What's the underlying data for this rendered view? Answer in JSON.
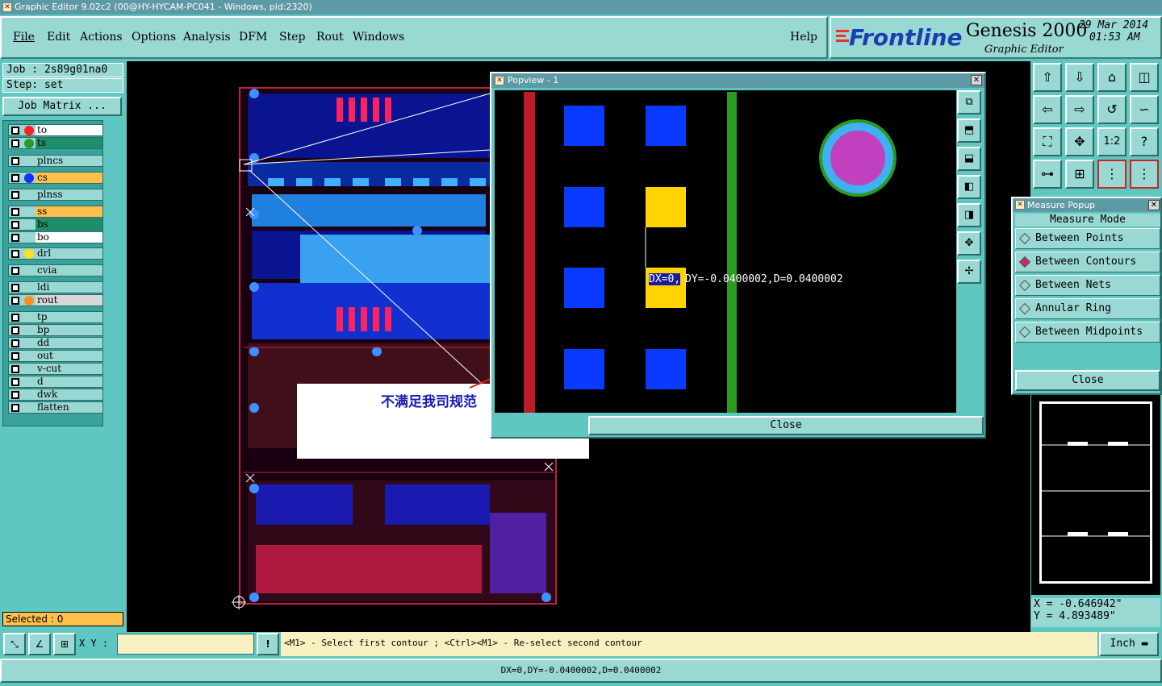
{
  "window": {
    "title": "Graphic Editor 9.02c2 (00@HY-HYCAM-PC041 - Windows, pid:2320)"
  },
  "menu": [
    "File",
    "Edit",
    "Actions",
    "Options",
    "Analysis",
    "DFM",
    "Step",
    "Rout",
    "Windows"
  ],
  "help_label": "Help",
  "brand": {
    "logo": "Frontline",
    "product": "Genesis 2000",
    "subtitle": "Graphic Editor",
    "date": "29 Mar 2014",
    "time": "01:53 AM"
  },
  "job": {
    "job_label": "Job : 2s89g01na0",
    "step_label": "Step: set",
    "matrix_button": "Job Matrix ..."
  },
  "layers": [
    {
      "name": "to",
      "color": "#ff2020",
      "bg": "#ffffff"
    },
    {
      "name": "ts",
      "color": "#2a9a2a",
      "bg": "#1f8f6a"
    },
    {
      "name": "plncs",
      "color": "",
      "bg": "#9ad8d4"
    },
    {
      "name": "cs",
      "color": "#1030ff",
      "bg": "#ffc04c"
    },
    {
      "name": "plnss",
      "color": "",
      "bg": "#9ad8d4"
    },
    {
      "name": "ss",
      "color": "",
      "bg": "#ffc04c"
    },
    {
      "name": "bs",
      "color": "",
      "bg": "#1f8f6a"
    },
    {
      "name": "bo",
      "color": "",
      "bg": "#ffffff"
    },
    {
      "name": "drl",
      "color": "#ffe020",
      "bg": "#9ad8d4"
    },
    {
      "name": "cvia",
      "color": "",
      "bg": "#9ad8d4"
    },
    {
      "name": "ldi",
      "color": "",
      "bg": "#9ad8d4"
    },
    {
      "name": "rout",
      "color": "#ff8c20",
      "bg": "#d8d8d8"
    },
    {
      "name": "tp",
      "color": "",
      "bg": "#9ad8d4"
    },
    {
      "name": "bp",
      "color": "",
      "bg": "#9ad8d4"
    },
    {
      "name": "dd",
      "color": "",
      "bg": "#9ad8d4"
    },
    {
      "name": "out",
      "color": "",
      "bg": "#9ad8d4"
    },
    {
      "name": "v-cut",
      "color": "",
      "bg": "#9ad8d4"
    },
    {
      "name": "d",
      "color": "",
      "bg": "#9ad8d4"
    },
    {
      "name": "dwk",
      "color": "",
      "bg": "#9ad8d4"
    },
    {
      "name": "flatten",
      "color": "",
      "bg": "#9ad8d4"
    }
  ],
  "selected_label": "Selected : 0",
  "popview": {
    "title": "Popview - 1",
    "measure_highlight": "DX=0,",
    "measure_rest": "DY=-0.0400002,D=0.0400002",
    "close": "Close"
  },
  "annotation": "不满足我司规范",
  "measure_popup": {
    "title": "Measure Popup",
    "mode_label": "Measure Mode",
    "options": [
      "Between Points",
      "Between Contours",
      "Between Nets",
      "Annular Ring",
      "Between Midpoints"
    ],
    "selected": "Between Contours",
    "close": "Close"
  },
  "coords": {
    "x": "X = -0.646942\"",
    "y": "Y = 4.893489\""
  },
  "bottom": {
    "xy_label": "X Y :",
    "xy_value": "",
    "prompt": "<M1> - Select first contour ; <Ctrl><M1> - Re-select second contour",
    "units": "Inch"
  },
  "status": "DX=0,DY=-0.0400002,D=0.0400002",
  "colors": {
    "background": "#5fc7c2",
    "panel": "#9ad8d4",
    "titlebar": "#5e9aa5",
    "canvas": "#000000",
    "highlight": "#1a1aa0"
  },
  "icons": [
    "zoom-home-icon",
    "zoom-in-icon",
    "zoom-out-icon",
    "pan-icon",
    "fit-icon",
    "one-to-one-icon",
    "help-icon",
    "measure-icon",
    "grid-icon",
    "layers-icon"
  ]
}
